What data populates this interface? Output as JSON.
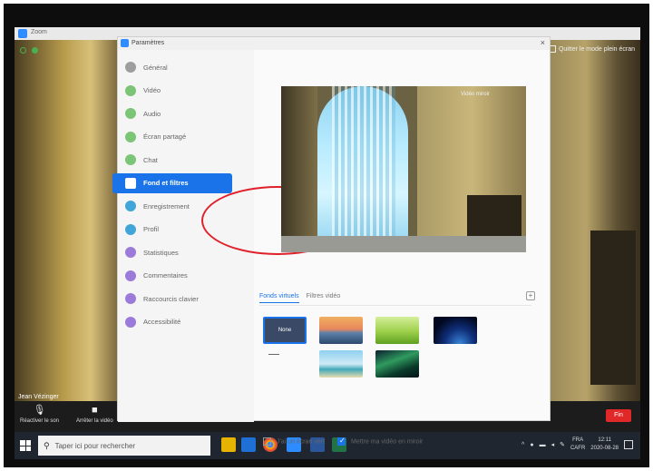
{
  "zoom": {
    "window_title": "Zoom",
    "fullscreen_label": "Quitter le mode plein écran",
    "user_name": "Jean Vézinger",
    "controls": {
      "mute_label": "Réactiver le son",
      "video_label": "Arrêter la vidéo",
      "end_label": "Fin"
    }
  },
  "settings": {
    "window_title": "Paramètres",
    "close_icon": "×",
    "sidebar": [
      {
        "label": "Général",
        "color": "#9e9e9e"
      },
      {
        "label": "Vidéo",
        "color": "#7cc576"
      },
      {
        "label": "Audio",
        "color": "#7cc576"
      },
      {
        "label": "Écran partagé",
        "color": "#7cc576"
      },
      {
        "label": "Chat",
        "color": "#7cc576"
      },
      {
        "label": "Fond et filtres",
        "color": "#ffffff"
      },
      {
        "label": "Enregistrement",
        "color": "#42a5d8"
      },
      {
        "label": "Profil",
        "color": "#42a5d8"
      },
      {
        "label": "Statistiques",
        "color": "#9c7ad9"
      },
      {
        "label": "Commentaires",
        "color": "#9c7ad9"
      },
      {
        "label": "Raccourcis clavier",
        "color": "#9c7ad9"
      },
      {
        "label": "Accessibilité",
        "color": "#9c7ad9"
      }
    ],
    "active_index": 5,
    "preview": {
      "mirror_label": "Vidéo miroir"
    },
    "tabs": [
      {
        "label": "Fonds virtuels",
        "active": true
      },
      {
        "label": "Filtres vidéo",
        "active": false
      }
    ],
    "add_icon": "+",
    "backgrounds": [
      {
        "label": "None",
        "kind": "none",
        "selected": true
      },
      {
        "label": "",
        "kind": "t-bridge"
      },
      {
        "label": "",
        "kind": "t-grass"
      },
      {
        "label": "",
        "kind": "t-earth"
      },
      {
        "label": "",
        "kind": "t-beach"
      },
      {
        "label": "",
        "kind": "t-aurora"
      }
    ],
    "footer": {
      "green_screen_label": "J'ai un écran vert",
      "green_screen_checked": false,
      "mirror_video_label": "Mettre ma vidéo en miroir",
      "mirror_video_checked": true
    }
  },
  "taskbar": {
    "search_placeholder": "Taper ici pour rechercher",
    "language": "FRA\nCAFR",
    "time": "12:11",
    "date": "2020-08-28"
  },
  "accent_colors": {
    "zoom_blue": "#1a73e8",
    "annotation_red": "#e0202a",
    "end_red": "#e02828"
  }
}
